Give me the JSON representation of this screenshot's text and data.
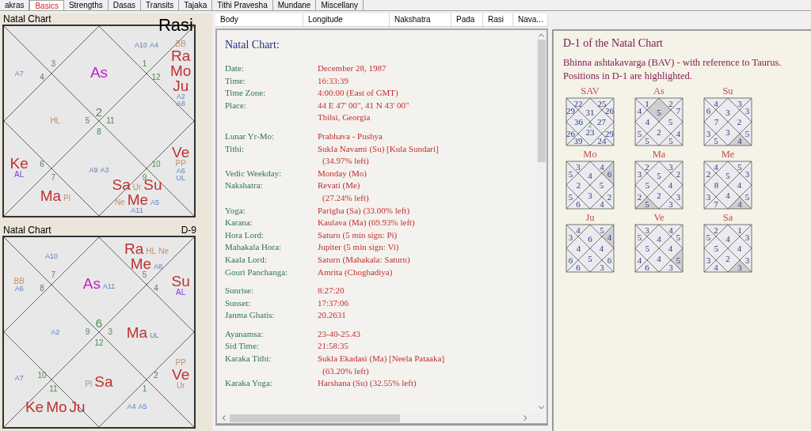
{
  "tabs": [
    {
      "label": "akras",
      "selected": false
    },
    {
      "label": "Basics",
      "selected": true
    },
    {
      "label": "Strengths",
      "selected": false
    },
    {
      "label": "Dasas",
      "selected": false
    },
    {
      "label": "Transits",
      "selected": false
    },
    {
      "label": "Tajaka",
      "selected": false
    },
    {
      "label": "Tithi Pravesha",
      "selected": false
    },
    {
      "label": "Mundane",
      "selected": false
    },
    {
      "label": "Miscellany",
      "selected": false
    }
  ],
  "charts": [
    {
      "title": "Natal Chart",
      "division": "Rasi",
      "signs": [
        "2",
        "3",
        "4",
        "5",
        "6",
        "7",
        "8",
        "9",
        "10",
        "11",
        "12",
        "1"
      ],
      "houses": [
        {
          "kind": "topright",
          "items": [
            {
              "text": "A10",
              "kind": "arudha"
            },
            {
              "text": "A4",
              "kind": "arudha"
            }
          ]
        },
        {
          "kind": "lefttop",
          "items": [
            {
              "text": "A7",
              "kind": "arudha"
            }
          ]
        },
        {
          "kind": "top",
          "items": [
            {
              "text": "As",
              "kind": "lagna"
            }
          ]
        },
        {
          "kind": "righttop",
          "items": [
            {
              "text": "BB",
              "kind": "special"
            },
            {
              "text": "Ra",
              "kind": "planet"
            },
            {
              "text": "Mo",
              "kind": "planet"
            },
            {
              "text": "Ju",
              "kind": "planet"
            },
            {
              "text": "A2",
              "kind": "arudha"
            },
            {
              "text": "A8",
              "kind": "arudha"
            }
          ]
        },
        {
          "kind": "left",
          "items": [
            {
              "text": "HL",
              "kind": "special"
            }
          ]
        },
        {
          "kind": "leftbottom",
          "items": [
            {
              "text": "Ke",
              "kind": "planet"
            },
            {
              "text": "AL",
              "kind": "al"
            }
          ]
        },
        {
          "kind": "bottom",
          "items": [
            {
              "text": "A9",
              "kind": "arudha"
            },
            {
              "text": "A3",
              "kind": "arudha"
            }
          ]
        },
        {
          "kind": "rightbottom",
          "items": [
            {
              "text": "Ve",
              "kind": "planet"
            },
            {
              "text": "PP",
              "kind": "special"
            },
            {
              "text": "A6",
              "kind": "arudha"
            },
            {
              "text": "UL",
              "kind": "arudha"
            }
          ]
        },
        {
          "kind": "bottomleft",
          "items": [
            {
              "text": "Ma",
              "kind": "planet"
            },
            {
              "text": "Pl",
              "kind": "special"
            }
          ]
        },
        {
          "kind": "bottomright",
          "items": [
            {
              "text": "Sa",
              "kind": "planet"
            },
            {
              "text": "Ur",
              "kind": "special"
            },
            {
              "text": "Su",
              "kind": "planet"
            },
            {
              "text": "Ne",
              "kind": "special"
            },
            {
              "text": "Me",
              "kind": "planet"
            },
            {
              "text": "A5",
              "kind": "arudha"
            },
            {
              "text": "A11",
              "kind": "arudha"
            }
          ]
        }
      ]
    },
    {
      "title": "Natal Chart",
      "division": "D-9",
      "signs": [
        "6",
        "7",
        "8",
        "9",
        "10",
        "11",
        "12",
        "1",
        "2",
        "3",
        "4",
        "5"
      ],
      "houses": [
        {
          "kind": "topleft",
          "items": [
            {
              "text": "A10",
              "kind": "arudha"
            }
          ]
        },
        {
          "kind": "topright",
          "items": [
            {
              "text": "Ra",
              "kind": "planet"
            },
            {
              "text": "HL",
              "kind": "special"
            },
            {
              "text": "Ne",
              "kind": "special"
            },
            {
              "text": "Me",
              "kind": "planet"
            },
            {
              "text": "A8",
              "kind": "arudha"
            }
          ]
        },
        {
          "kind": "lefttop",
          "items": [
            {
              "text": "BB",
              "kind": "special"
            },
            {
              "text": "A6",
              "kind": "arudha"
            }
          ]
        },
        {
          "kind": "top",
          "items": [
            {
              "text": "As",
              "kind": "lagna"
            },
            {
              "text": "A11",
              "kind": "arudha"
            }
          ]
        },
        {
          "kind": "righttop",
          "items": [
            {
              "text": "Su",
              "kind": "planet"
            },
            {
              "text": "AL",
              "kind": "al"
            }
          ]
        },
        {
          "kind": "left",
          "items": [
            {
              "text": "A2",
              "kind": "arudha"
            }
          ]
        },
        {
          "kind": "right",
          "items": [
            {
              "text": "Ma",
              "kind": "planet"
            },
            {
              "text": "UL",
              "kind": "arudha"
            }
          ]
        },
        {
          "kind": "leftbottom",
          "items": [
            {
              "text": "A7",
              "kind": "arudha"
            }
          ]
        },
        {
          "kind": "bottom",
          "items": [
            {
              "text": "Pl",
              "kind": "special"
            },
            {
              "text": "Sa",
              "kind": "planet"
            }
          ]
        },
        {
          "kind": "rightbottom",
          "items": [
            {
              "text": "PP",
              "kind": "special"
            },
            {
              "text": "Ve",
              "kind": "planet"
            },
            {
              "text": "Ur",
              "kind": "special"
            }
          ]
        },
        {
          "kind": "bottomleft",
          "items": [
            {
              "text": "Ke",
              "kind": "planet"
            },
            {
              "text": "Mo",
              "kind": "planet"
            },
            {
              "text": "Ju",
              "kind": "planet"
            }
          ]
        },
        {
          "kind": "bottomright",
          "items": [
            {
              "text": "A4",
              "kind": "arudha"
            },
            {
              "text": "A5",
              "kind": "arudha"
            }
          ]
        }
      ]
    }
  ],
  "table": {
    "columns": [
      "Body",
      "Longitude",
      "Nakshatra",
      "Pada",
      "Rasi",
      "Nava..."
    ]
  },
  "details": {
    "title": "Natal Chart:",
    "groups": [
      [
        {
          "label": "Date:",
          "value": [
            "December 28, 1987"
          ]
        },
        {
          "label": "Time:",
          "value": [
            "16:33:39"
          ]
        },
        {
          "label": "Time Zone:",
          "value": [
            "4:00:00 (East of GMT)"
          ]
        },
        {
          "label": "Place:",
          "value": [
            "44 E 47' 00\", 41 N 43' 00\"",
            "Tbilsi, Georgia"
          ]
        }
      ],
      [
        {
          "label": "Lunar Yr-Mo:",
          "value": [
            "Prabhava - Pushya"
          ]
        },
        {
          "label": "Tithi:",
          "value": [
            "Sukla Navami (Su) [Kula Sundari]",
            "(34.97% left)"
          ]
        },
        {
          "label": "Vedic Weekday:",
          "value": [
            "Monday (Mo)"
          ]
        },
        {
          "label": "Nakshatra:",
          "value": [
            "Revati (Me)",
            "(27.24% left)"
          ]
        },
        {
          "label": "Yoga:",
          "value": [
            "Parigha (Sa) (33.00% left)"
          ]
        },
        {
          "label": "Karana:",
          "value": [
            "Kaulava (Ma) (69.93% left)"
          ]
        },
        {
          "label": "Hora Lord:",
          "value": [
            "Saturn (5 min sign: Pi)"
          ]
        },
        {
          "label": "Mahakala Hora:",
          "value": [
            "Jupiter (5 min sign: Vi)"
          ]
        },
        {
          "label": "Kaala Lord:",
          "value": [
            "Saturn (Mahakala: Saturn)"
          ]
        },
        {
          "label": "Gouri Panchanga:",
          "value": [
            "Amrita (Choghadiya)"
          ]
        }
      ],
      [
        {
          "label": "Sunrise:",
          "value": [
            "8:27:20"
          ]
        },
        {
          "label": "Sunset:",
          "value": [
            "17:37:06"
          ]
        },
        {
          "label": "Janma Ghatis:",
          "value": [
            "20.2631"
          ]
        }
      ],
      [
        {
          "label": "Ayanamsa:",
          "value": [
            "23-40-25.43"
          ]
        },
        {
          "label": "Sid Time:",
          "value": [
            "21:58:35"
          ]
        },
        {
          "label": "Karaka Tithi:",
          "value": [
            "Sukla Ekadasi (Ma) [Neela Pataaka]",
            "(63.20% left)"
          ]
        },
        {
          "label": "Karaka Yoga:",
          "value": [
            "Harshana (Su) (32.55% left)"
          ]
        }
      ]
    ]
  },
  "ashtakavarga": {
    "title": "D-1 of the Natal Chart",
    "description": "Bhinna ashtakavarga (BAV) - with reference to Taurus. Positions in D-1 are highlighted.",
    "charts": [
      {
        "label": "SAV",
        "center": "2",
        "houses": [
          {
            "value": "31",
            "highlighted": false
          },
          {
            "value": "22",
            "highlighted": false
          },
          {
            "value": "29",
            "highlighted": false
          },
          {
            "value": "36",
            "highlighted": false
          },
          {
            "value": "26",
            "highlighted": false
          },
          {
            "value": "39",
            "highlighted": false
          },
          {
            "value": "23",
            "highlighted": false
          },
          {
            "value": "24",
            "highlighted": false
          },
          {
            "value": "29",
            "highlighted": false
          },
          {
            "value": "27",
            "highlighted": false
          },
          {
            "value": "26",
            "highlighted": false
          },
          {
            "value": "25",
            "highlighted": false
          }
        ]
      },
      {
        "label": "As",
        "houses": [
          {
            "value": "5",
            "highlighted": true
          },
          {
            "value": "1",
            "highlighted": false
          },
          {
            "value": "4",
            "highlighted": false
          },
          {
            "value": "4",
            "highlighted": false
          },
          {
            "value": "5",
            "highlighted": false
          },
          {
            "value": "5",
            "highlighted": false
          },
          {
            "value": "2",
            "highlighted": false
          },
          {
            "value": "5",
            "highlighted": false
          },
          {
            "value": "4",
            "highlighted": false
          },
          {
            "value": "5",
            "highlighted": false
          },
          {
            "value": "7",
            "highlighted": false
          },
          {
            "value": "2",
            "highlighted": false
          }
        ]
      },
      {
        "label": "Su",
        "houses": [
          {
            "value": "3",
            "highlighted": false
          },
          {
            "value": "4",
            "highlighted": false
          },
          {
            "value": "6",
            "highlighted": false
          },
          {
            "value": "7",
            "highlighted": false
          },
          {
            "value": "3",
            "highlighted": false
          },
          {
            "value": "5",
            "highlighted": false
          },
          {
            "value": "3",
            "highlighted": false
          },
          {
            "value": "4",
            "highlighted": true
          },
          {
            "value": "5",
            "highlighted": false
          },
          {
            "value": "2",
            "highlighted": false
          },
          {
            "value": "3",
            "highlighted": false
          },
          {
            "value": "3",
            "highlighted": false
          }
        ]
      },
      {
        "label": "Mo",
        "houses": [
          {
            "value": "4",
            "highlighted": false
          },
          {
            "value": "3",
            "highlighted": false
          },
          {
            "value": "5",
            "highlighted": false
          },
          {
            "value": "2",
            "highlighted": false
          },
          {
            "value": "5",
            "highlighted": false
          },
          {
            "value": "6",
            "highlighted": false
          },
          {
            "value": "3",
            "highlighted": false
          },
          {
            "value": "4",
            "highlighted": false
          },
          {
            "value": "2",
            "highlighted": false
          },
          {
            "value": "5",
            "highlighted": false
          },
          {
            "value": "6",
            "highlighted": true
          },
          {
            "value": "4",
            "highlighted": false
          }
        ]
      },
      {
        "label": "Ma",
        "houses": [
          {
            "value": "5",
            "highlighted": false
          },
          {
            "value": "2",
            "highlighted": false
          },
          {
            "value": "3",
            "highlighted": false
          },
          {
            "value": "5",
            "highlighted": false
          },
          {
            "value": "2",
            "highlighted": false
          },
          {
            "value": "5",
            "highlighted": true
          },
          {
            "value": "2",
            "highlighted": false
          },
          {
            "value": "3",
            "highlighted": false
          },
          {
            "value": "3",
            "highlighted": false
          },
          {
            "value": "4",
            "highlighted": false
          },
          {
            "value": "2",
            "highlighted": false
          },
          {
            "value": "3",
            "highlighted": false
          }
        ]
      },
      {
        "label": "Me",
        "houses": [
          {
            "value": "5",
            "highlighted": false
          },
          {
            "value": "4",
            "highlighted": false
          },
          {
            "value": "2",
            "highlighted": false
          },
          {
            "value": "8",
            "highlighted": false
          },
          {
            "value": "3",
            "highlighted": false
          },
          {
            "value": "7",
            "highlighted": false
          },
          {
            "value": "4",
            "highlighted": false
          },
          {
            "value": "4",
            "highlighted": true
          },
          {
            "value": "5",
            "highlighted": false
          },
          {
            "value": "4",
            "highlighted": false
          },
          {
            "value": "3",
            "highlighted": false
          },
          {
            "value": "5",
            "highlighted": false
          }
        ]
      },
      {
        "label": "Ju",
        "houses": [
          {
            "value": "6",
            "highlighted": false
          },
          {
            "value": "4",
            "highlighted": false
          },
          {
            "value": "3",
            "highlighted": false
          },
          {
            "value": "4",
            "highlighted": false
          },
          {
            "value": "6",
            "highlighted": false
          },
          {
            "value": "6",
            "highlighted": false
          },
          {
            "value": "5",
            "highlighted": false
          },
          {
            "value": "3",
            "highlighted": false
          },
          {
            "value": "6",
            "highlighted": false
          },
          {
            "value": "4",
            "highlighted": false
          },
          {
            "value": "4",
            "highlighted": true
          },
          {
            "value": "5",
            "highlighted": false
          }
        ]
      },
      {
        "label": "Ve",
        "houses": [
          {
            "value": "4",
            "highlighted": false
          },
          {
            "value": "3",
            "highlighted": false
          },
          {
            "value": "5",
            "highlighted": false
          },
          {
            "value": "5",
            "highlighted": false
          },
          {
            "value": "4",
            "highlighted": false
          },
          {
            "value": "6",
            "highlighted": false
          },
          {
            "value": "4",
            "highlighted": false
          },
          {
            "value": "3",
            "highlighted": false
          },
          {
            "value": "5",
            "highlighted": true
          },
          {
            "value": "4",
            "highlighted": false
          },
          {
            "value": "5",
            "highlighted": false
          },
          {
            "value": "4",
            "highlighted": false
          }
        ]
      },
      {
        "label": "Sa",
        "houses": [
          {
            "value": "4",
            "highlighted": false
          },
          {
            "value": "2",
            "highlighted": false
          },
          {
            "value": "5",
            "highlighted": false
          },
          {
            "value": "5",
            "highlighted": false
          },
          {
            "value": "3",
            "highlighted": false
          },
          {
            "value": "4",
            "highlighted": false
          },
          {
            "value": "2",
            "highlighted": false
          },
          {
            "value": "3",
            "highlighted": true
          },
          {
            "value": "3",
            "highlighted": false
          },
          {
            "value": "4",
            "highlighted": false
          },
          {
            "value": "3",
            "highlighted": false
          },
          {
            "value": "1",
            "highlighted": false
          }
        ]
      }
    ]
  }
}
